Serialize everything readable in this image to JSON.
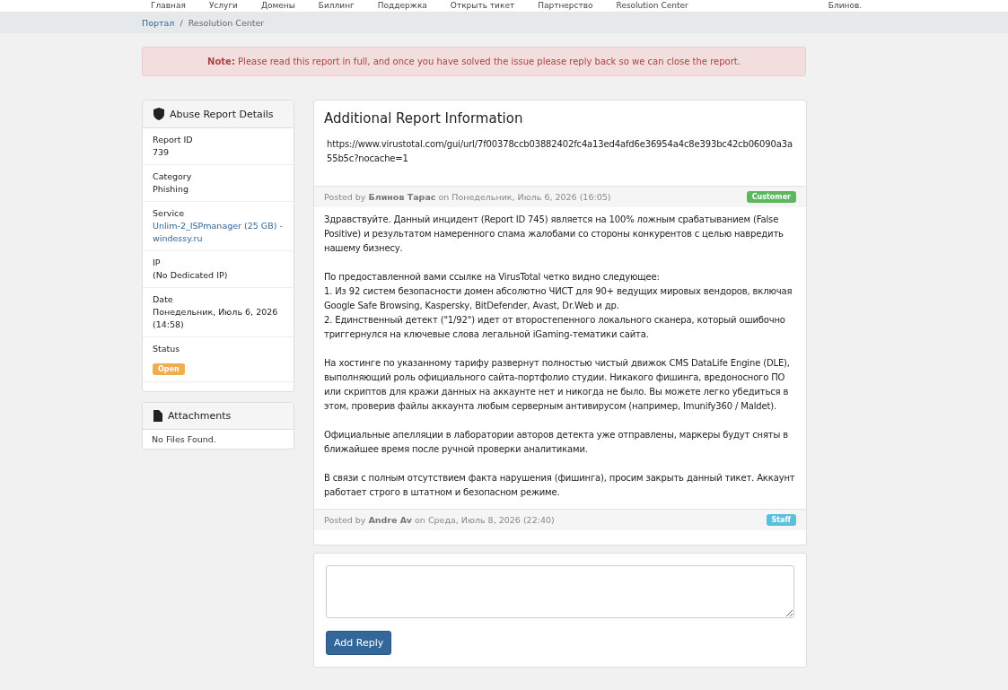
{
  "nav": [
    "Главная",
    "Услуги",
    "Домены",
    "Биллинг",
    "Поддержка",
    "Открыть тикет",
    "Партнерство",
    "Resolution Center",
    "Блинов."
  ],
  "breadcrumb": [
    {
      "label": "Портал",
      "kind": "link"
    },
    {
      "label": "/",
      "kind": "separator"
    },
    {
      "label": "Resolution Center",
      "kind": "current"
    }
  ],
  "alert": "**Note:** Please read this report in full, and once you have solved the issue please reply back so we can close the report.",
  "details": {
    "title": "Abuse Report Details",
    "items": [
      {
        "label": "Report ID",
        "value": "739",
        "kind": "text"
      },
      {
        "label": "Category",
        "value": "Phishing",
        "kind": "text"
      },
      {
        "label": "Service",
        "value": "Unlim-2_ISPmanager (25 GB) - windessy.ru",
        "kind": "link"
      },
      {
        "label": "IP",
        "value": "(No Dedicated IP)",
        "kind": "text"
      },
      {
        "label": "Date",
        "value": "Понедельник, Июль 6, 2026 (14:58)",
        "kind": "text"
      },
      {
        "label": "Status",
        "value": "Open",
        "kind": "badge"
      }
    ]
  },
  "attachments": {
    "title": "Attachments",
    "empty": "No Files Found."
  },
  "report": {
    "title": "Additional Report Information",
    "url": "https://www.virustotal.com/gui/url/7f00378ccb03882402fc4a13ed4afd6e36954a4c8e393bc42cb06090a3a55b5c?nocache=1",
    "posts": [
      {
        "posted": "Posted by **Блинов Тарас** on Понедельник, Июль 6, 2026 (16:05)",
        "role": "Customer",
        "kind": "customer",
        "paragraphs": [
          [
            "Здравствуйте. Данный инцидент (Report ID 745) является на 100% ложным срабатыванием (False Positive) и результатом намеренного спама жалобами со стороны конкурентов с целью навредить нашему бизнесу."
          ],
          [
            "По предоставленной вами ссылке на VirusTotal четко видно следующее:",
            "1. Из 92 систем безопасности домен абсолютно ЧИСТ для 90+ ведущих мировых вендоров, включая Google Safe Browsing, Kaspersky, BitDefender, Avast, Dr.Web и др.",
            "2. Единственный детект (\"1/92\") идет от второстепенного локального сканера, который ошибочно триггернулся на ключевые слова легальной iGaming-тематики сайта."
          ],
          [
            "На хостинге по указанному тарифу развернут полностью чистый движок CMS DataLife Engine (DLE), выполняющий роль официального сайта-портфолио студии. Никакого фишинга, вредоносного ПО или скриптов для кражи данных на аккаунте нет и никогда не было. Вы можете легко убедиться в этом, проверив файлы аккаунта любым серверным антивирусом (например, Imunify360 / Maldet)."
          ],
          [
            "Официальные апелляции в лаборатории авторов детекта уже отправлены, маркеры будут сняты в ближайшее время после ручной проверки аналитиками."
          ],
          [
            "В связи с полным отсутствием факта нарушения (фишинга), просим закрыть данный тикет. Аккаунт работает строго в штатном и безопасном режиме."
          ]
        ]
      },
      {
        "posted": "Posted by **Andre Av** on Среда, Июль 8, 2026 (22:40)",
        "role": "Staff",
        "kind": "staff"
      }
    ]
  },
  "reply": {
    "button": "Add Reply"
  }
}
